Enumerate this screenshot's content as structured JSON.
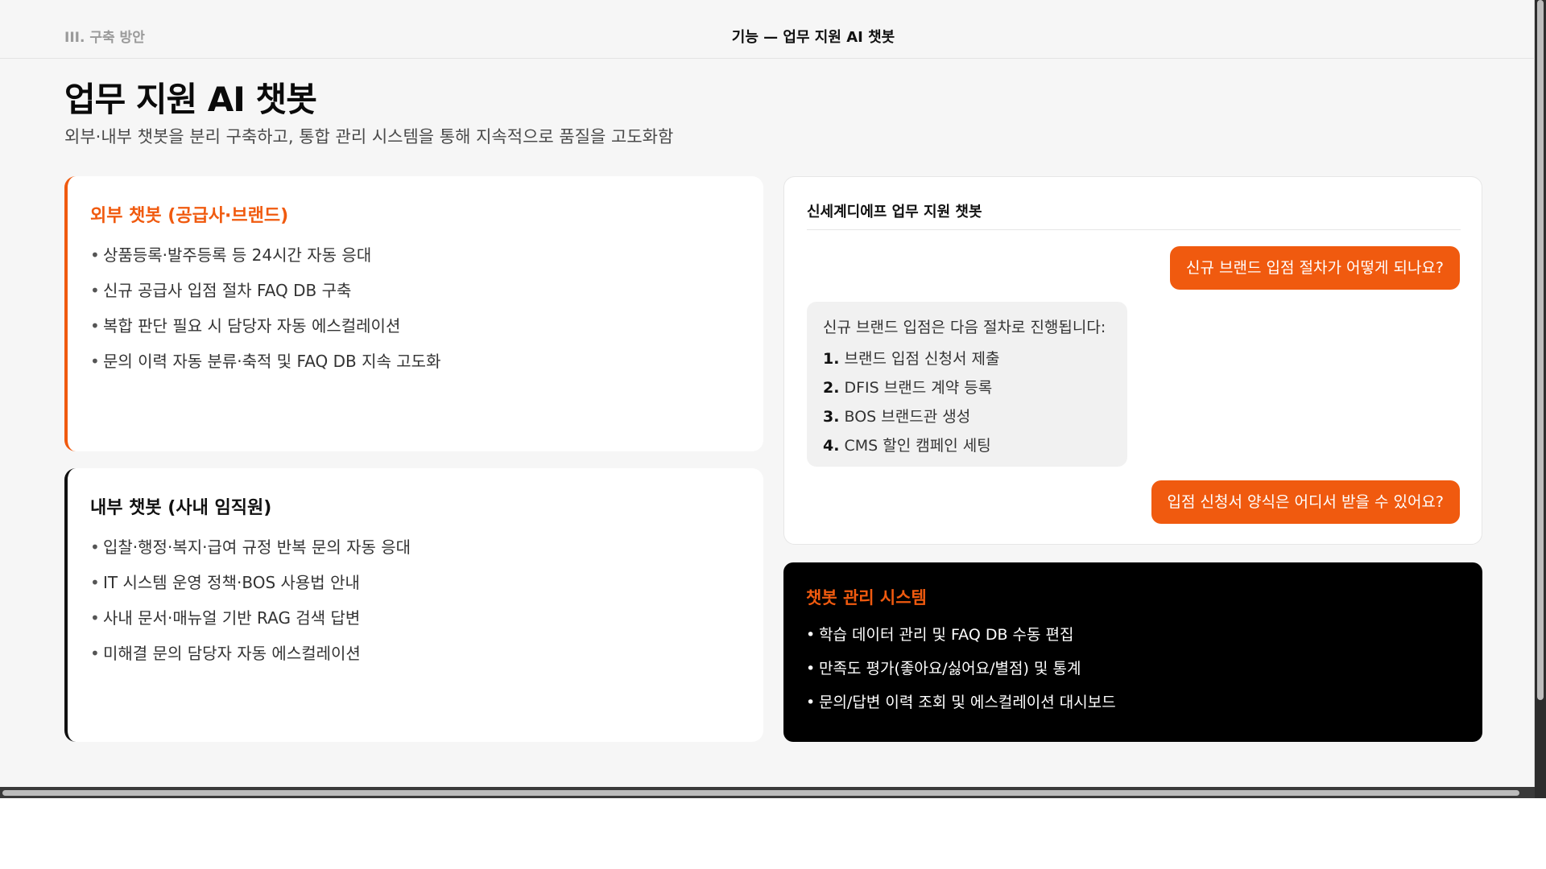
{
  "header": {
    "section": "III. 구축 방안",
    "title": "기능 — 업무 지원 AI 챗봇"
  },
  "page": {
    "title": "업무 지원 AI 챗봇",
    "subtitle": "외부·내부 챗봇을 분리 구축하고, 통합 관리 시스템을 통해 지속적으로 품질을 고도화함"
  },
  "external_card": {
    "title": "외부 챗봇 (공급사·브랜드)",
    "items": [
      "상품등록·발주등록 등 24시간 자동 응대",
      "신규 공급사 입점 절차 FAQ DB 구축",
      "복합 판단 필요 시 담당자 자동 에스컬레이션",
      "문의 이력 자동 분류·축적 및 FAQ DB 지속 고도화"
    ]
  },
  "internal_card": {
    "title": "내부 챗봇 (사내 임직원)",
    "items": [
      "입찰·행정·복지·급여 규정 반복 문의 자동 응대",
      "IT 시스템 운영 정책·BOS 사용법 안내",
      "사내 문서·매뉴얼 기반 RAG 검색 답변",
      "미해결 문의 담당자 자동 에스컬레이션"
    ]
  },
  "chat": {
    "title": "신세계디에프 업무 지원 챗봇",
    "user_q1": "신규 브랜드 입점 절차가 어떻게 되나요?",
    "bot_intro": "신규 브랜드 입점은 다음 절차로 진행됩니다:",
    "steps": [
      {
        "num": "1.",
        "text": "브랜드 입점 신청서 제출"
      },
      {
        "num": "2.",
        "text": "DFIS 브랜드 계약 등록"
      },
      {
        "num": "3.",
        "text": "BOS 브랜드관 생성"
      },
      {
        "num": "4.",
        "text": "CMS 할인 캠페인 세팅"
      }
    ],
    "user_q2": "입점 신청서 양식은 어디서 받을 수 있어요?"
  },
  "management": {
    "title": "챗봇 관리 시스템",
    "items": [
      "학습 데이터 관리 및 FAQ DB 수동 편집",
      "만족도 평가(좋아요/싫어요/별점) 및 통계",
      "문의/답변 이력 조회 및 에스컬레이션 대시보드"
    ]
  },
  "bullet": "•",
  "colors": {
    "accent": "#f05a0f",
    "background": "#f6f6f6",
    "card": "#ffffff",
    "management_bg": "#000000"
  }
}
